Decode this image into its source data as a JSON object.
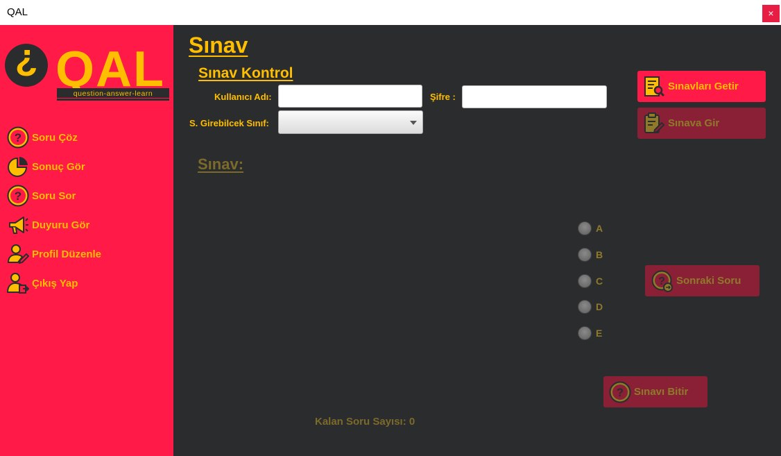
{
  "window": {
    "title": "QAL",
    "close_glyph": "×"
  },
  "logo": {
    "text": "QAL",
    "tagline": "question-answer-learn"
  },
  "sidebar": {
    "items": [
      {
        "label": "Soru Çöz",
        "icon": "question-circle-icon"
      },
      {
        "label": "Sonuç Gör",
        "icon": "pie-chart-icon"
      },
      {
        "label": "Soru Sor",
        "icon": "question-circle-icon"
      },
      {
        "label": "Duyuru Gör",
        "icon": "megaphone-icon"
      },
      {
        "label": "Profil Düzenle",
        "icon": "user-edit-icon"
      },
      {
        "label": "Çıkış Yap",
        "icon": "user-logout-icon"
      }
    ]
  },
  "main": {
    "title": "Sınav",
    "subtitle": "Sınav Kontrol",
    "form": {
      "username_label": "Kullanıcı Adı:",
      "username_value": "",
      "password_label": "Şifre :",
      "password_value": "",
      "class_label": "S. Girebilcek Sınıf:",
      "class_value": ""
    },
    "buttons": {
      "get_exams": "Sınavları Getir",
      "enter_exam": "Sınava Gir",
      "next_question": "Sonraki Soru",
      "finish_exam": "Sınavı Bitir"
    },
    "exam_label": "Sınav:",
    "options": [
      "A",
      "B",
      "C",
      "D",
      "E"
    ],
    "remaining_label": "Kalan Soru Sayısı: 0"
  },
  "colors": {
    "accent": "#ffbf00",
    "sidebar": "#ff1a47",
    "background": "#2b2c2e",
    "disabled_button": "#8a2036"
  }
}
